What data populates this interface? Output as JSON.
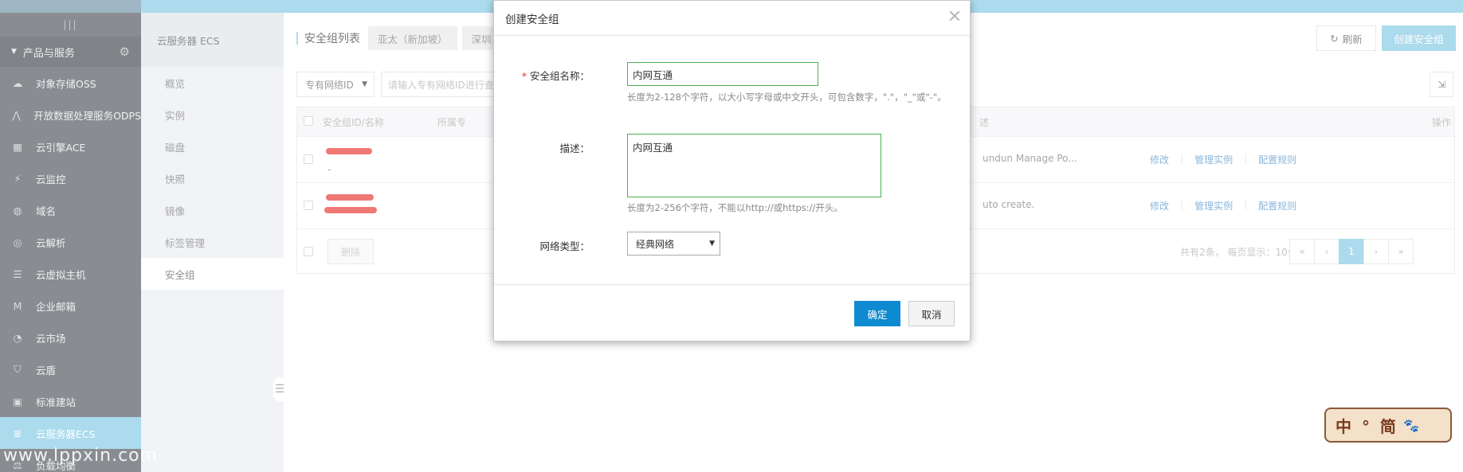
{
  "sidebar": {
    "section_label": "产品与服务",
    "items": [
      {
        "label": "对象存储OSS",
        "icon": "cloud-upload-icon"
      },
      {
        "label": "开放数据处理服务ODPS",
        "icon": "graph-icon"
      },
      {
        "label": "云引擎ACE",
        "icon": "grid-icon"
      },
      {
        "label": "云监控",
        "icon": "pulse-icon"
      },
      {
        "label": "域名",
        "icon": "globe-icon"
      },
      {
        "label": "云解析",
        "icon": "dns-icon"
      },
      {
        "label": "云虚拟主机",
        "icon": "server-stack-icon"
      },
      {
        "label": "企业邮箱",
        "icon": "mail-m-icon"
      },
      {
        "label": "云市场",
        "icon": "market-icon"
      },
      {
        "label": "云盾",
        "icon": "shield-icon"
      },
      {
        "label": "标准建站",
        "icon": "site-icon"
      },
      {
        "label": "云服务器ECS",
        "icon": "server-icon",
        "active": true
      },
      {
        "label": "负载均衡",
        "icon": "balance-icon"
      }
    ]
  },
  "subnav": {
    "title": "云服务器 ECS",
    "items": [
      "概览",
      "实例",
      "磁盘",
      "快照",
      "镜像",
      "标签管理",
      "安全组"
    ],
    "active": "安全组"
  },
  "main": {
    "section_title": "安全组列表",
    "region_tabs": [
      "亚太（新加坡）",
      "深圳"
    ],
    "refresh_label": "刷新",
    "create_label": "创建安全组",
    "filter_select": "专有网络ID",
    "filter_placeholder": "请输入专有网络ID进行查",
    "table": {
      "headers": {
        "id_name": "安全组ID/名称",
        "vpc": "所属专",
        "desc": "述",
        "ops": "操作"
      },
      "rows": [
        {
          "sub": "-",
          "desc": "undun Manage Po...",
          "ops": [
            "修改",
            "管理实例",
            "配置规则"
          ]
        },
        {
          "sub": "",
          "desc": "uto create.",
          "ops": [
            "修改",
            "管理实例",
            "配置规则"
          ]
        }
      ],
      "delete_label": "删除",
      "pager_text": "共有2条， 每页显示：10条",
      "pager": [
        "«",
        "‹",
        "1",
        "›",
        "»"
      ]
    }
  },
  "modal": {
    "title": "创建安全组",
    "name_label": "安全组名称：",
    "name_value": "内网互通",
    "name_hint": "长度为2-128个字符，以大小写字母或中文开头，可包含数字，\".\"，\"_\"或\"-\"。",
    "desc_label": "描述：",
    "desc_value": "内网互通",
    "desc_hint": "长度为2-256个字符，不能以http://或https://开头。",
    "net_label": "网络类型：",
    "net_value": "经典网络",
    "ok_label": "确定",
    "cancel_label": "取消"
  },
  "badge": {
    "text": "中 ° 简"
  },
  "watermark": "www.lppxin.com"
}
